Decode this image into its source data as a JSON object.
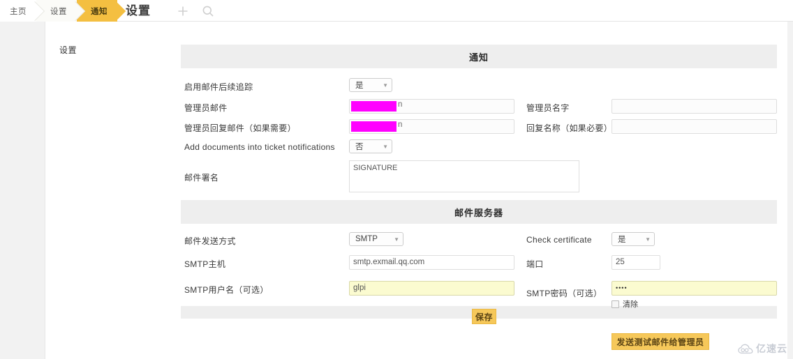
{
  "topbar": {
    "breadcrumbs": [
      {
        "label": "主页"
      },
      {
        "label": "设置"
      },
      {
        "label": "通知"
      }
    ],
    "page_title": "设置",
    "add_icon": "plus-icon",
    "search_icon": "search-icon"
  },
  "sidebar": {
    "label": "设置"
  },
  "sections": {
    "notification": {
      "title": "通知",
      "rows": {
        "followup": {
          "label": "启用邮件后续追踪",
          "value": "是"
        },
        "admin_email": {
          "label": "管理员邮件",
          "redacted": true,
          "visible_tail": "n"
        },
        "admin_name": {
          "label": "管理员名字",
          "value": ""
        },
        "reply_email": {
          "label": "管理员回复邮件（如果需要）",
          "redacted": true,
          "visible_tail": "n"
        },
        "reply_name": {
          "label": "回复名称（如果必要）",
          "value": ""
        },
        "add_documents": {
          "label": "Add documents into ticket notifications",
          "value": "否"
        },
        "signature": {
          "label": "邮件署名",
          "value": "SIGNATURE"
        }
      }
    },
    "mail_server": {
      "title": "邮件服务器",
      "rows": {
        "send_method": {
          "label": "邮件发送方式",
          "value": "SMTP"
        },
        "check_certificate": {
          "label": "Check certificate",
          "value": "是"
        },
        "smtp_host": {
          "label": "SMTP主机",
          "value": "smtp.exmail.qq.com"
        },
        "port": {
          "label": "端口",
          "value": "25"
        },
        "smtp_user": {
          "label": "SMTP用户名（可选）",
          "value": "glpi"
        },
        "smtp_password": {
          "label": "SMTP密码（可选）",
          "value": "••••",
          "clear_label": "清除"
        }
      }
    }
  },
  "actions": {
    "save": "保存",
    "send_test": "发送测试邮件给管理员"
  },
  "watermark": {
    "text": "亿速云",
    "icon": "cloud-icon"
  },
  "colors": {
    "accent": "#f4bf41",
    "button": "#f6c85a",
    "section_bg": "#eeeeee",
    "redaction": "#ff00ff",
    "field_highlight": "#fbfbd0"
  }
}
